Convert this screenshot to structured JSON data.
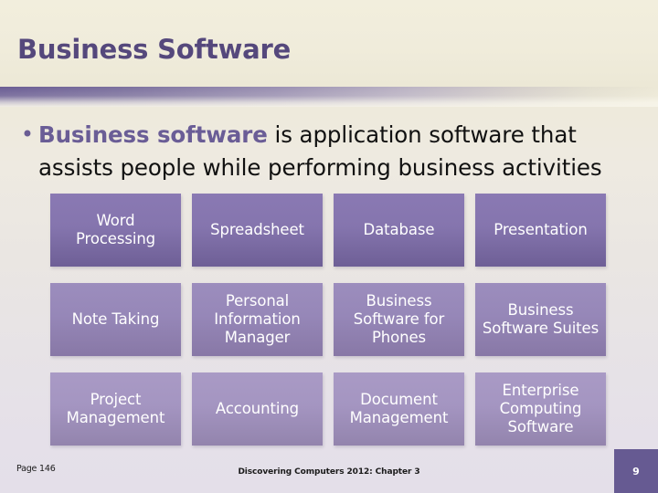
{
  "slide": {
    "title": "Business Software",
    "bullet": {
      "marker": "bullet-dot",
      "lead": "Business software",
      "rest": " is application software that assists people while performing business activities"
    },
    "matrix": {
      "rows": [
        {
          "cells": [
            {
              "label": "Word Processing"
            },
            {
              "label": "Spreadsheet"
            },
            {
              "label": "Database"
            },
            {
              "label": "Presentation"
            }
          ]
        },
        {
          "cells": [
            {
              "label": "Note Taking"
            },
            {
              "label": "Personal Information Manager"
            },
            {
              "label": "Business Software for Phones"
            },
            {
              "label": "Business Software Suites"
            }
          ]
        },
        {
          "cells": [
            {
              "label": "Project Management"
            },
            {
              "label": "Accounting"
            },
            {
              "label": "Document Management"
            },
            {
              "label": "Enterprise Computing Software"
            }
          ]
        }
      ]
    },
    "footer": {
      "page_reference": "Page 146",
      "source": "Discovering Computers 2012: Chapter 3",
      "slide_number": "9"
    },
    "colors": {
      "title_purple": "#55487c",
      "lead_purple": "#6a5d96",
      "divider_purple": "#6a5d94",
      "row_1_fill": "#8575ae",
      "row_2_fill": "#9687b8",
      "row_3_fill": "#a495c1",
      "slide_number_fill": "#665a92",
      "background_top": "#efebdb",
      "background_bottom": "#e4dfe9"
    }
  }
}
